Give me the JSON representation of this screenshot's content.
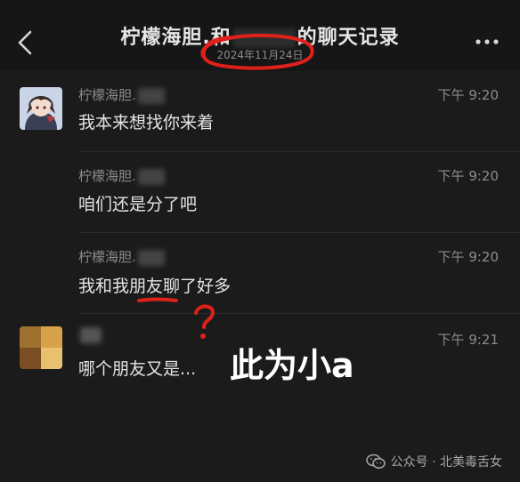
{
  "header": {
    "title_left": "柠檬海胆.和",
    "title_right": "的聊天记录",
    "date": "2024年11月24日"
  },
  "messages": [
    {
      "sender": "柠檬海胆.",
      "time": "下午 9:20",
      "text": "我本来想找你来着"
    },
    {
      "sender": "柠檬海胆.",
      "time": "下午 9:20",
      "text": "咱们还是分了吧"
    },
    {
      "sender": "柠檬海胆.",
      "time": "下午 9:20",
      "text": "我和我朋友聊了好多"
    },
    {
      "sender": "",
      "time": "下午 9:21",
      "text": "哪个朋友又是..."
    }
  ],
  "annotation": {
    "label": "此为小a",
    "question": "?"
  },
  "footer": {
    "text": "公众号 · 北美毒舌女"
  },
  "colors": {
    "accent_red": "#e0201a",
    "background": "#1b1b1b"
  }
}
